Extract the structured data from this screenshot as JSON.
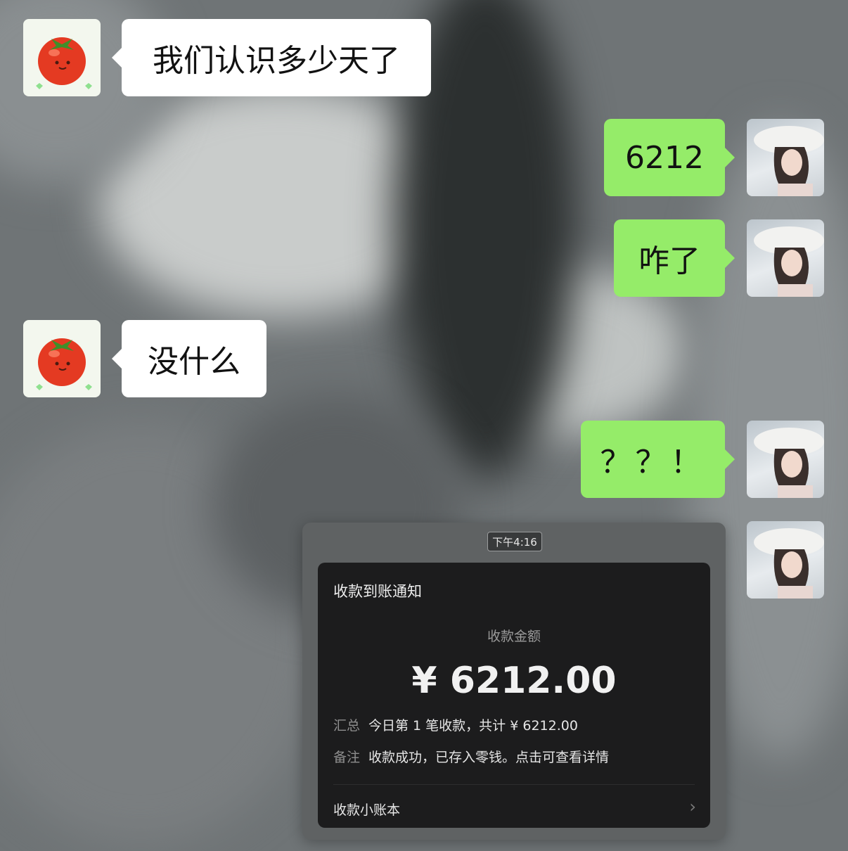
{
  "messages": [
    {
      "side": "left",
      "text": "我们认识多少天了"
    },
    {
      "side": "right",
      "text": "6212"
    },
    {
      "side": "right",
      "text": "咋了"
    },
    {
      "side": "left",
      "text": "没什么"
    },
    {
      "side": "right",
      "text": "？？！"
    }
  ],
  "payment_card": {
    "time": "下午4:16",
    "title": "收款到账通知",
    "amount_label": "收款金额",
    "amount": "¥ 6212.00",
    "summary_label": "汇总",
    "summary_value": "今日第 1 笔收款，共计 ¥ 6212.00",
    "note_label": "备注",
    "note_value": "收款成功，已存入零钱。点击可查看详情",
    "footer_link": "收款小账本"
  },
  "colors": {
    "bubble_self": "#95ec69",
    "bubble_other": "#ffffff",
    "card_bg": "#1c1c1d"
  },
  "icons": {
    "contact_avatar": "tomato-avatar",
    "self_avatar": "girl-in-hat-avatar",
    "footer_arrow": "chevron-right-icon"
  }
}
